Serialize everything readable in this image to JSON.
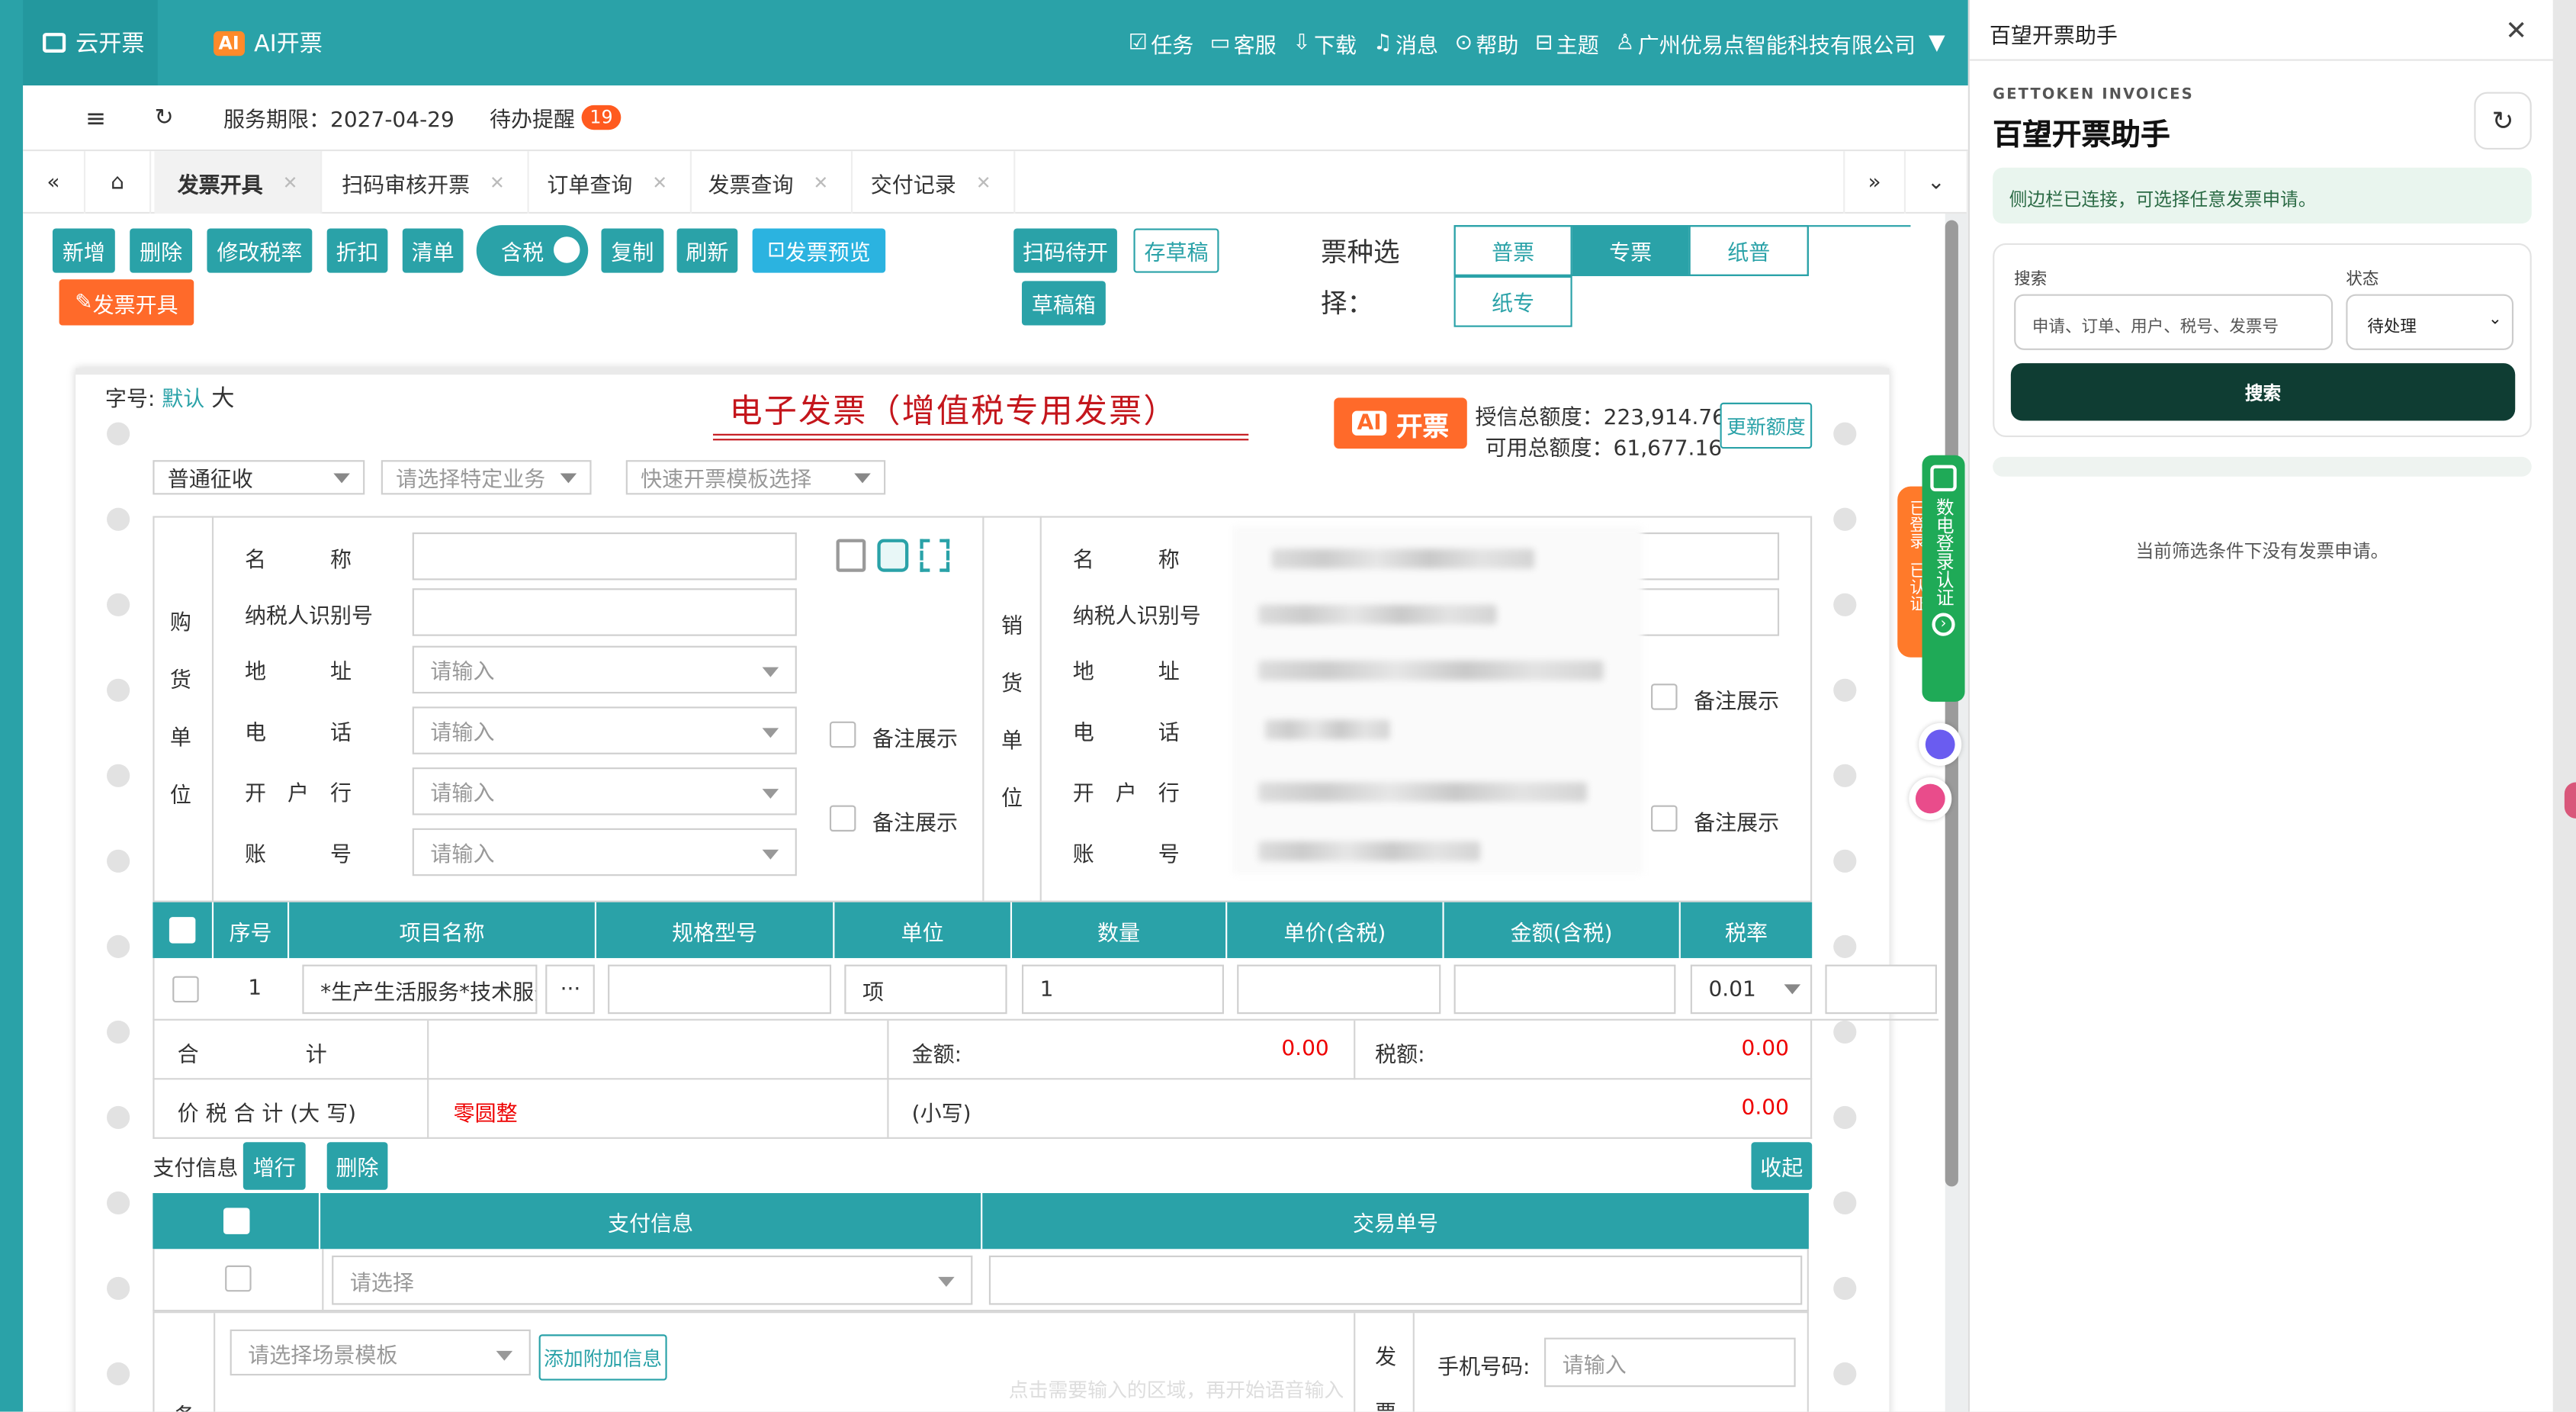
{
  "topbar": {
    "tab1": "云开票",
    "tab2_badge": "AI",
    "tab2": "AI开票",
    "menu": [
      "任务",
      "客服",
      "下载",
      "消息",
      "帮助",
      "主题",
      "广州优易点智能科技有限公司"
    ]
  },
  "toolbar": {
    "service_label": "服务期限：",
    "service_date": "2027-04-29",
    "todo_label": "待办提醒",
    "todo_count": "19"
  },
  "tabs": [
    "发票开具",
    "扫码审核开票",
    "订单查询",
    "发票查询",
    "交付记录"
  ],
  "buttons": {
    "add": "新增",
    "delete": "删除",
    "modify_rate": "修改税率",
    "discount": "折扣",
    "clear": "清单",
    "tax_toggle": "含税",
    "copy": "复制",
    "refresh": "刷新",
    "preview": "发票预览",
    "scan_pending": "扫码待开",
    "save_draft": "存草稿",
    "draft_box": "草稿箱",
    "issue": "发票开具"
  },
  "ticket_type": {
    "label": "票种选择：",
    "options": [
      "普票",
      "专票",
      "纸普",
      "纸专"
    ],
    "selected": "专票"
  },
  "invoice": {
    "serial_label": "字号:",
    "serial_default": "默认",
    "serial_size": "大",
    "title": "电子发票（增值税专用发票）",
    "ai_badge": "AI",
    "ai_text": "开票",
    "credit_total_label": "授信总额度：",
    "credit_total": "223,914.76",
    "available_label": "可用总额度：",
    "available": "61,677.16",
    "update_quota": "更新额度",
    "collection_type": "普通征收",
    "special_business": "请选择特定业务",
    "quick_template": "快速开票模板选择"
  },
  "buyer": {
    "side_label": [
      "购",
      "货",
      "单",
      "位"
    ],
    "fields": [
      "名　　　称",
      "纳税人识别号",
      "地　　　址",
      "电　　　话",
      "开　户　行",
      "账　　　号"
    ],
    "placeholder": "请输入",
    "remark_show": "备注展示"
  },
  "seller": {
    "side_label": [
      "销",
      "货",
      "单",
      "位"
    ],
    "fields": [
      "名　　　称",
      "纳税人识别号",
      "地　　　址",
      "电　　　话",
      "开　户　行",
      "账　　　号"
    ],
    "remark_show": "备注展示"
  },
  "items_table": {
    "headers": [
      "序号",
      "项目名称",
      "规格型号",
      "单位",
      "数量",
      "单价(含税)",
      "金额(含税)",
      "税率"
    ],
    "row": {
      "index": "1",
      "name": "*生产生活服务*技术服务",
      "more": "···",
      "unit": "项",
      "qty": "1",
      "rate": "0.01"
    }
  },
  "totals": {
    "sum_label": "合　　　　　计",
    "amount_label": "金额:",
    "amount": "0.00",
    "tax_label": "税额:",
    "tax": "0.00",
    "total_upper_label": "价 税 合 计 (大 写)",
    "total_upper": "零圆整",
    "small_label": "(小写)",
    "total_small": "0.00"
  },
  "payment": {
    "label": "支付信息",
    "add_row": "增行",
    "delete": "删除",
    "collapse": "收起",
    "headers": [
      "支付信息",
      "交易单号"
    ],
    "select_placeholder": "请选择"
  },
  "extra": {
    "scene_template": "请选择场景模板",
    "add_extra": "添加附加信息",
    "side_char": "发",
    "side_char2": "票",
    "remark_char": "备",
    "phone_label": "手机号码:",
    "phone_placeholder": "请输入",
    "hint": "点击需要输入的区域，再开始语音输入"
  },
  "floatbar": {
    "logged": "已登录",
    "certified": "已认证",
    "digital_login": "数电登录认证"
  },
  "sidepanel": {
    "title": "百望开票助手",
    "eyebrow": "GETTOKEN INVOICES",
    "heading": "百望开票助手",
    "connected": "侧边栏已连接，可选择任意发票申请。",
    "search_label": "搜索",
    "search_placeholder": "申请、订单、用户、税号、发票号",
    "status_label": "状态",
    "status_value": "待处理",
    "search_button": "搜索",
    "empty": "当前筛选条件下没有发票申请。"
  },
  "colors": {
    "teal": "#2aa2a8",
    "orange": "#ff6a2a",
    "red": "#e60000",
    "dark_green": "#0f3d33"
  }
}
